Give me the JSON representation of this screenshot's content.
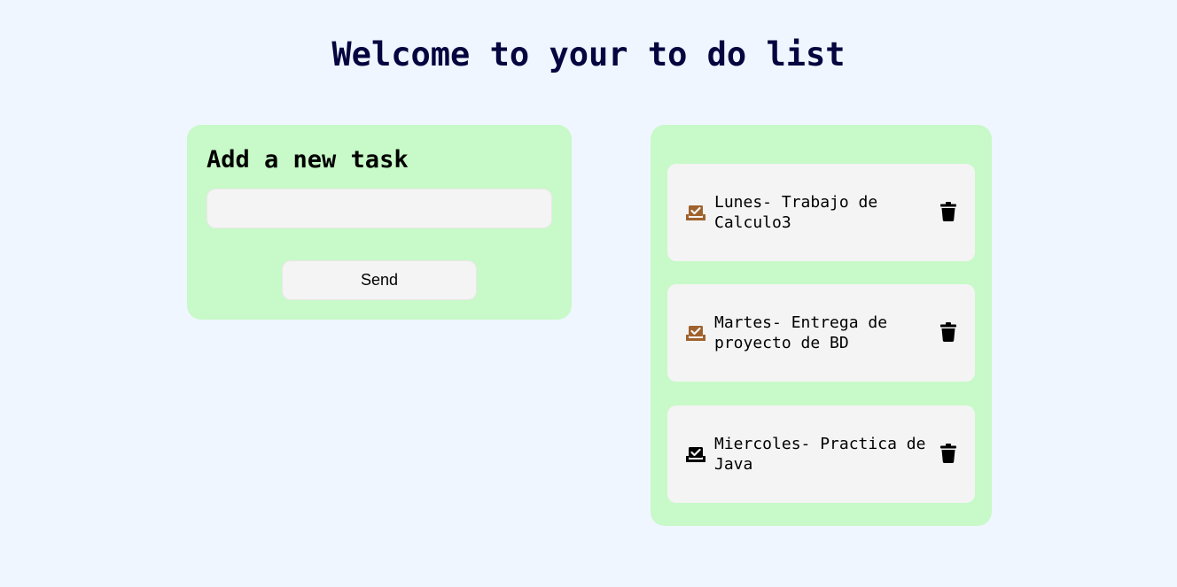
{
  "page": {
    "title": "Welcome to your to do list"
  },
  "add_panel": {
    "heading": "Add a new task",
    "input_value": "",
    "input_placeholder": "",
    "send_label": "Send"
  },
  "tasks": [
    {
      "text": "Lunes- Trabajo de Calculo3",
      "icon": "inbox-check-icon",
      "icon_color": "#a0622d"
    },
    {
      "text": "Martes- Entrega de proyecto de BD",
      "icon": "inbox-check-icon",
      "icon_color": "#a0622d"
    },
    {
      "text": "Miercoles- Practica de Java",
      "icon": "inbox-check-icon",
      "icon_color": "#000000"
    }
  ],
  "delete_icon": "trash-icon",
  "colors": {
    "background": "#eff6ff",
    "panel": "#c8f9c8",
    "field": "#f4f4f4",
    "title": "#05053f"
  }
}
